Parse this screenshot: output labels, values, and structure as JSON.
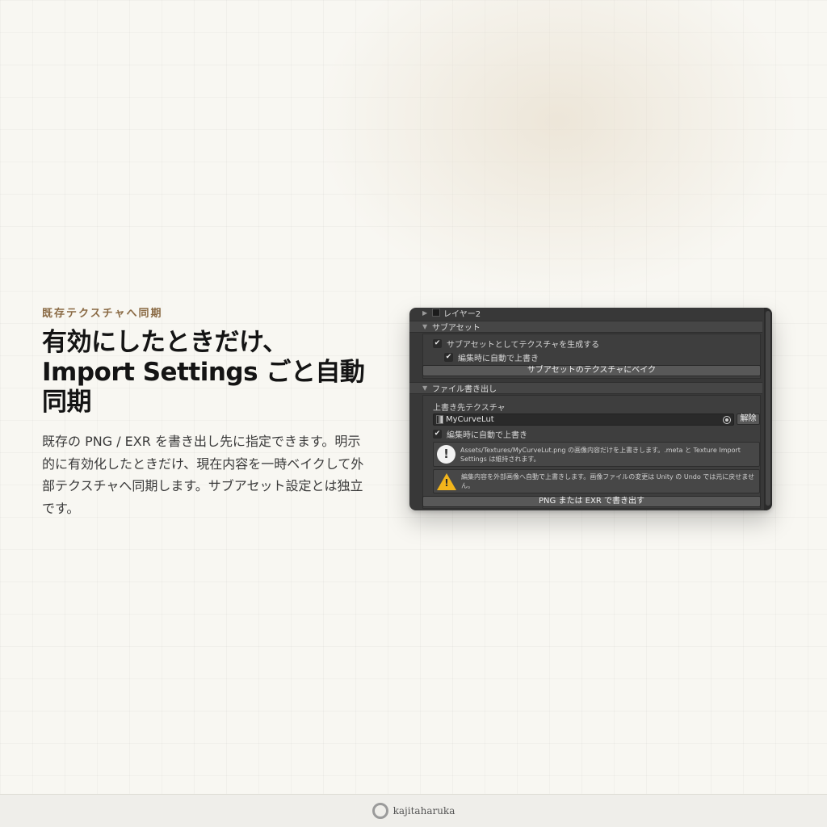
{
  "feature": {
    "eyebrow": "既存テクスチャへ同期",
    "headline": [
      "有効にしたときだけ、",
      "Import Settings ごと自動",
      "同期"
    ],
    "description": "既存の PNG / EXR を書き出し先に指定できます。明示的に有効化したときだけ、現在内容を一時ベイクして外部テクスチャへ同期します。サブアセット設定とは独立です。"
  },
  "inspector": {
    "layer_label": "レイヤー2",
    "subasset_section": {
      "header": "サブアセット",
      "generate_label": "サブアセットとしてテクスチャを生成する",
      "generate_checked": true,
      "auto_overwrite_label": "編集時に自動で上書き",
      "auto_overwrite_checked": true,
      "bake_button": "サブアセットのテクスチャにベイク"
    },
    "file_export_section": {
      "header": "ファイル書き出し",
      "target_label": "上書き先テクスチャ",
      "target_value": "MyCurveLut",
      "release_button": "解除",
      "auto_overwrite_label": "編集時に自動で上書き",
      "auto_overwrite_checked": true,
      "info_message": "Assets/Textures/MyCurveLut.png の画像内容だけを上書きします。.meta と Texture Import Settings は維持されます。",
      "warning_message": "編集内容を外部画像へ自動で上書きします。画像ファイルの変更は Unity の Undo では元に戻せません。",
      "export_button": "PNG または EXR で書き出す"
    },
    "icons": {
      "expand": "triangle-right-icon",
      "collapse": "triangle-down-icon",
      "check": "checkmark-icon",
      "info": "info-icon",
      "warning": "warning-icon",
      "picker": "object-picker-icon"
    }
  },
  "footer": {
    "brand": "kajitaharuka"
  },
  "colors": {
    "accent": "#8a6a44",
    "panel_bg": "#383838",
    "warning": "#f2b51c"
  }
}
